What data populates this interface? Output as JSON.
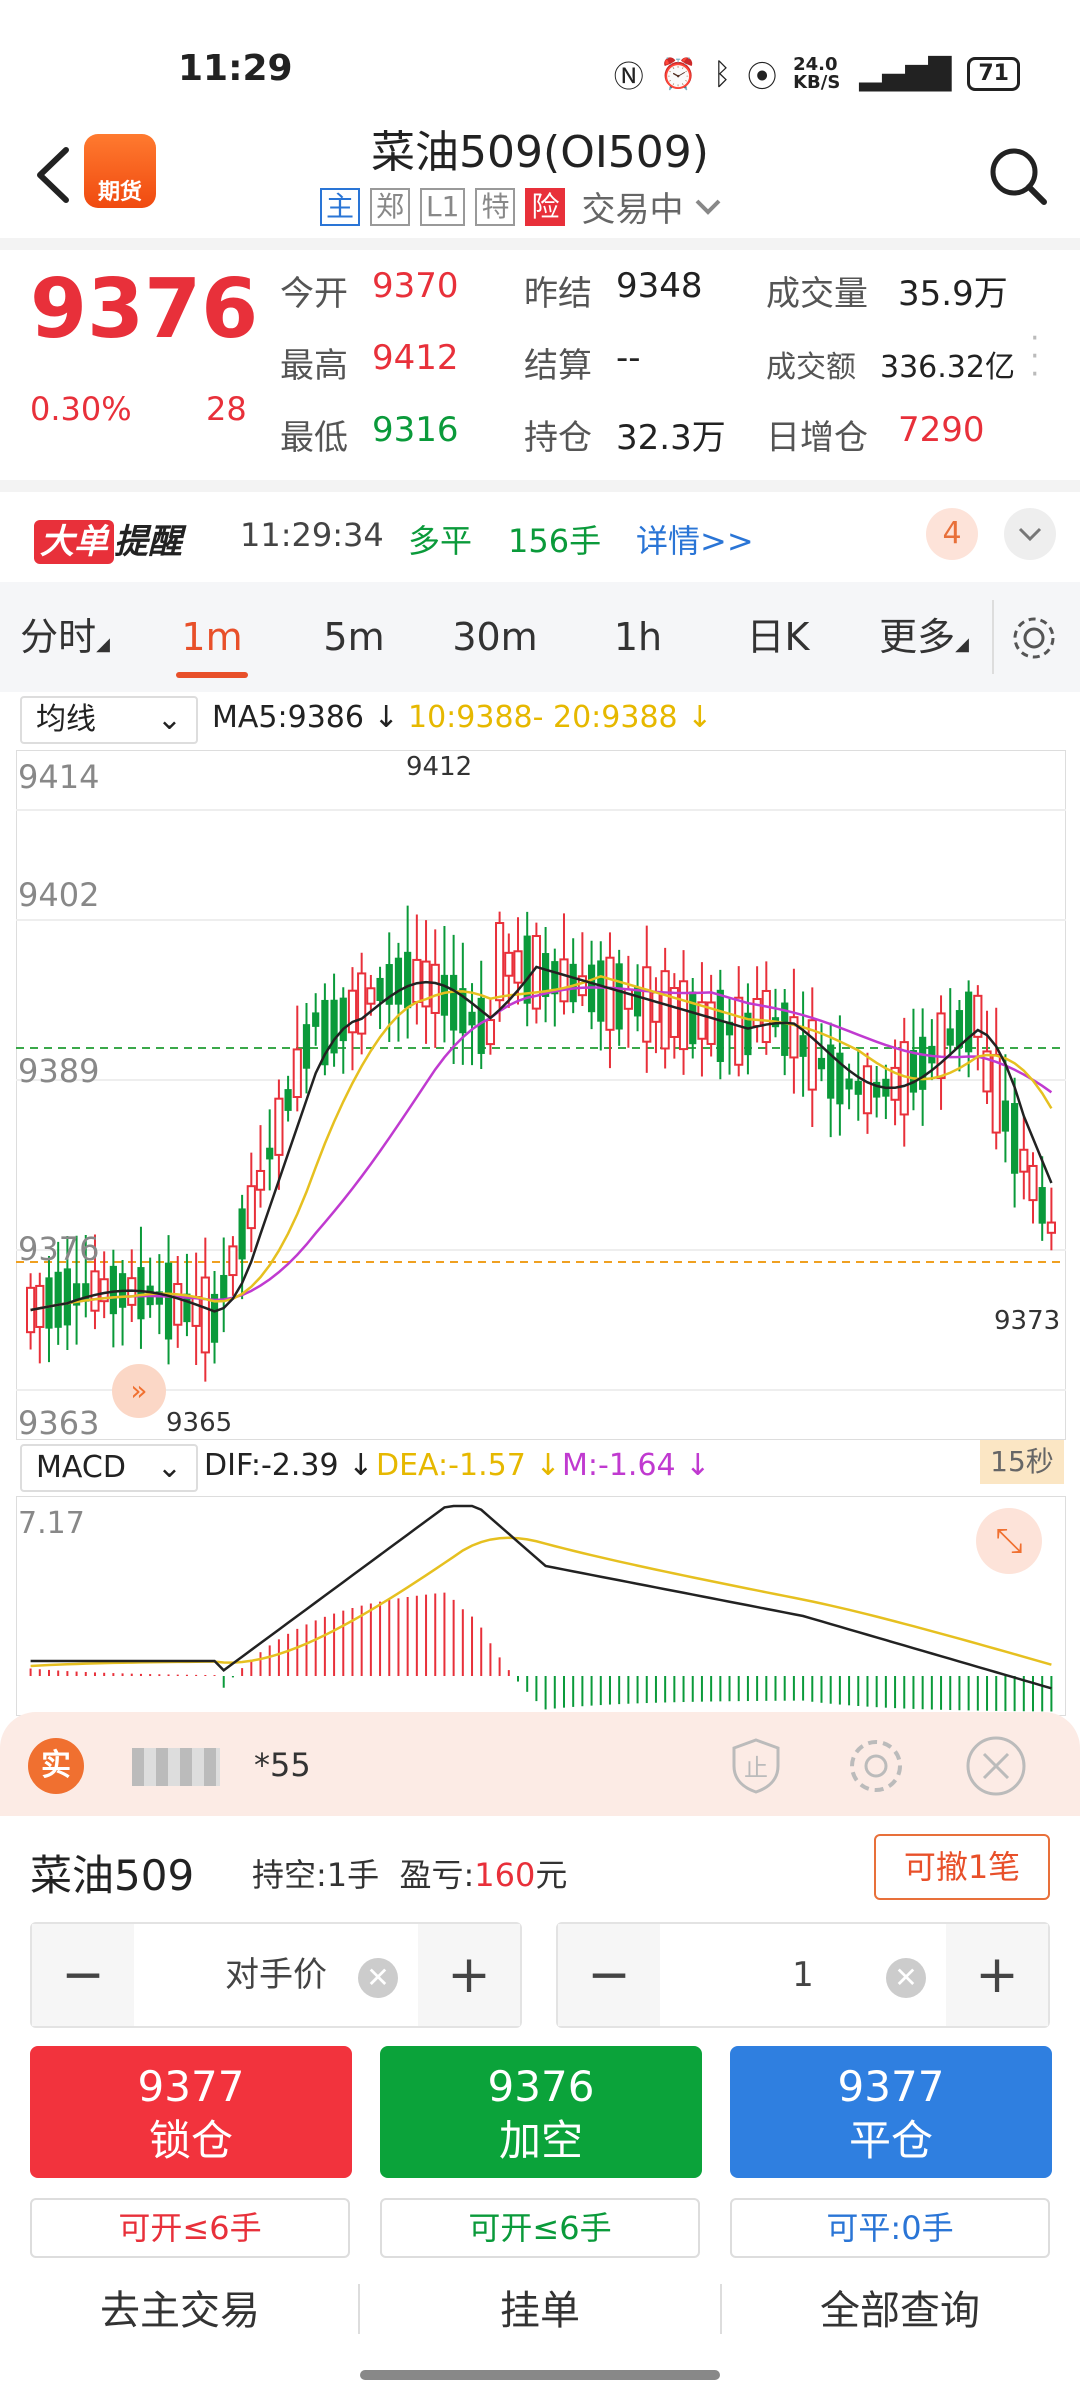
{
  "status_bar": {
    "time": "11:29",
    "net_speed": "24.0 KB/S",
    "battery": "71"
  },
  "header": {
    "logo_text": "期货",
    "title": "菜油509(OI509)",
    "tags": [
      "主",
      "郑",
      "L1",
      "特",
      "险"
    ],
    "trading_status": "交易中"
  },
  "quote": {
    "price": "9376",
    "change_pct": "0.30%",
    "change": "28",
    "open_label": "今开",
    "open": "9370",
    "prev_close_label": "昨结",
    "prev_close": "9348",
    "volume_label": "成交量",
    "volume": "35.9万",
    "high_label": "最高",
    "high": "9412",
    "settle_label": "结算",
    "settle": "--",
    "turnover_label": "成交额",
    "turnover": "336.32亿",
    "low_label": "最低",
    "low": "9316",
    "oi_label": "持仓",
    "oi": "32.3万",
    "oi_change_label": "日增仓",
    "oi_change": "7290"
  },
  "alert": {
    "badge_a": "大单",
    "badge_b": "提醒",
    "time": "11:29:34",
    "direction": "多平",
    "volume": "156手",
    "detail": "详情>>",
    "count": "4"
  },
  "period_tabs": [
    "分时",
    "1m",
    "5m",
    "30m",
    "1h",
    "日K",
    "更多"
  ],
  "active_tab": "1m",
  "main_chart": {
    "selector": "均线",
    "ma5": "MA5:9386 ↓",
    "ma10_20": "10:9388- 20:9388 ↓",
    "y_labels": [
      "9414",
      "9402",
      "9389",
      "9376",
      "9363"
    ],
    "high_mark": "9412",
    "low_mark": "9365",
    "last_mark": "9373"
  },
  "macd": {
    "selector": "MACD",
    "dif": "DIF:-2.39 ↓",
    "dea": "DEA:-1.57 ↓",
    "m": "M:-1.64 ↓",
    "y_top": "7.17",
    "interval": "15秒"
  },
  "colors": {
    "up": "#e8303a",
    "down": "#0a9a3a",
    "accent": "#e8502a",
    "blue": "#2a75d6",
    "ma5": "#222222",
    "ma10": "#e6c020",
    "ma20": "#c03ad0"
  },
  "trade": {
    "badge": "实",
    "account_suffix": "*55",
    "instrument": "菜油509",
    "position_label": "持空:1手",
    "pnl_label": "盈亏:",
    "pnl_value": "160",
    "pnl_unit": "元",
    "cancel_btn": "可撤1笔",
    "price_type": "对手价",
    "qty": "1",
    "buttons": [
      {
        "price": "9377",
        "label": "锁仓"
      },
      {
        "price": "9376",
        "label": "加空"
      },
      {
        "price": "9377",
        "label": "平仓"
      }
    ],
    "avail": [
      "可开≤6手",
      "可开≤6手",
      "可平:0手"
    ]
  },
  "bottom_nav": [
    "去主交易",
    "挂单",
    "全部查询"
  ]
}
